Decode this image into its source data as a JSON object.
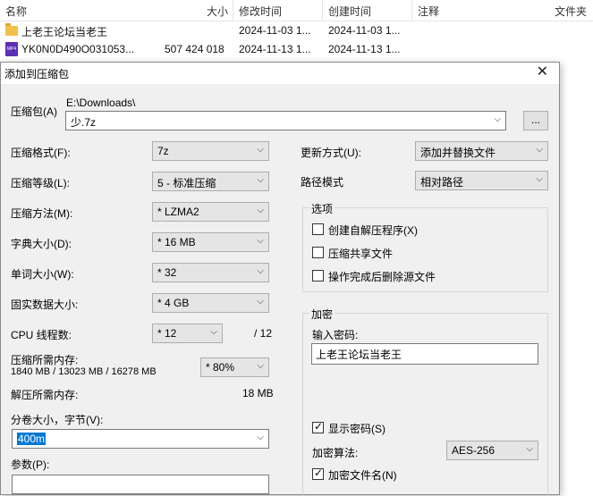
{
  "explorer": {
    "columns": {
      "name": "名称",
      "size": "大小",
      "modified": "修改时间",
      "created": "创建时间",
      "comment": "注释",
      "folder": "文件夹"
    },
    "rows": [
      {
        "icon": "folder-icon",
        "name": "上老王论坛当老王",
        "size": "",
        "modified": "2024-11-03 1...",
        "created": "2024-11-03 1..."
      },
      {
        "icon": "mp4-file-icon",
        "name": "YK0N0D490O031053...",
        "size": "507 424 018",
        "modified": "2024-11-13 1...",
        "created": "2024-11-13 1..."
      }
    ]
  },
  "dialog": {
    "title": "添加到压缩包",
    "archive": {
      "label": "压缩包(A)",
      "path": "E:\\Downloads\\",
      "value": "少.7z",
      "browse_label": "..."
    },
    "left": {
      "format": {
        "label": "压缩格式(F):",
        "value": "7z"
      },
      "level": {
        "label": "压缩等级(L):",
        "value": "5 - 标准压缩"
      },
      "method": {
        "label": "压缩方法(M):",
        "value": "*  LZMA2"
      },
      "dict": {
        "label": "字典大小(D):",
        "value": "*  16 MB"
      },
      "word": {
        "label": "单词大小(W):",
        "value": "*  32"
      },
      "solid": {
        "label": "固实数据大小:",
        "value": "*  4 GB"
      },
      "threads": {
        "label": "CPU 线程数:",
        "value": "*  12",
        "max": "/ 12"
      },
      "mem_compress": {
        "label": "压缩所需内存:",
        "detail": "1840 MB / 13023 MB / 16278 MB",
        "value": "*  80%"
      },
      "mem_decompress": {
        "label": "解压所需内存:",
        "value": "18 MB"
      },
      "volume": {
        "label": "分卷大小，字节(V):",
        "value": "400m"
      },
      "params": {
        "label": "参数(P):",
        "value": ""
      }
    },
    "right": {
      "update": {
        "label": "更新方式(U):",
        "value": "添加并替换文件"
      },
      "pathmode": {
        "label": "路径模式",
        "value": "相对路径"
      },
      "options": {
        "title": "选项",
        "sfx": "创建自解压程序(X)",
        "shared": "压缩共享文件",
        "delete": "操作完成后删除源文件"
      },
      "encryption": {
        "title": "加密",
        "password_label": "输入密码:",
        "password_value": "上老王论坛当老王",
        "show_password": "显示密码(S)",
        "method_label": "加密算法:",
        "method_value": "AES-256",
        "encrypt_names": "加密文件名(N)"
      }
    }
  }
}
